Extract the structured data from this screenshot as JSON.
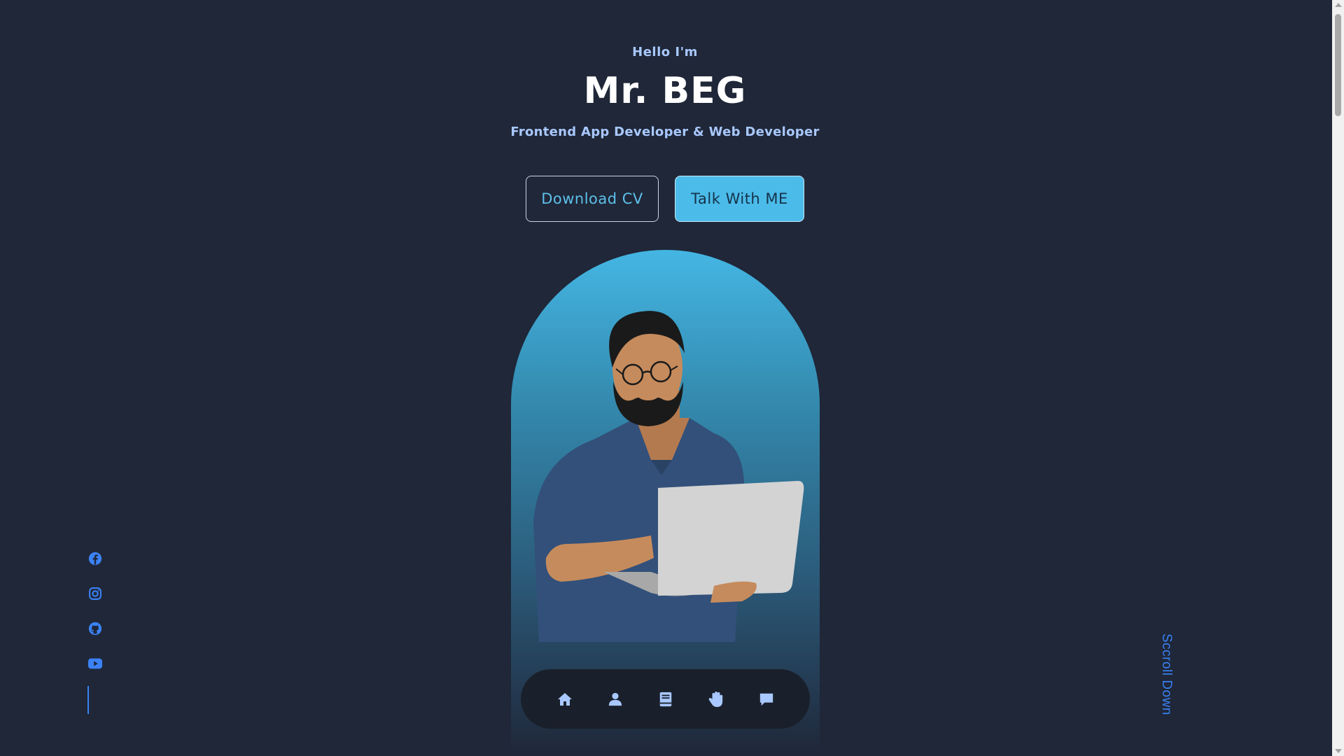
{
  "hero": {
    "greeting": "Hello I'm",
    "name": "Mr. BEG",
    "role": "Frontend App Developer & Web Developer"
  },
  "buttons": {
    "download_cv": "Download CV",
    "talk_with_me": "Talk With ME"
  },
  "dock_nav": {
    "items": [
      {
        "icon": "home-icon"
      },
      {
        "icon": "user-icon"
      },
      {
        "icon": "book-icon"
      },
      {
        "icon": "hand-icon"
      },
      {
        "icon": "message-icon"
      }
    ]
  },
  "social_links": {
    "items": [
      {
        "icon": "facebook-icon"
      },
      {
        "icon": "instagram-icon"
      },
      {
        "icon": "github-icon"
      },
      {
        "icon": "youtube-icon"
      }
    ]
  },
  "scroll_down": {
    "label": "Sccroll Down"
  },
  "colors": {
    "background": "#1f2738",
    "accent": "#4bbbe9",
    "accent_text": "#5ec0ea",
    "link_blue": "#3b82f6",
    "subtitle": "#a9c8ff",
    "dock_bg": "#1a202b",
    "dock_icon": "#a9c8ff"
  }
}
